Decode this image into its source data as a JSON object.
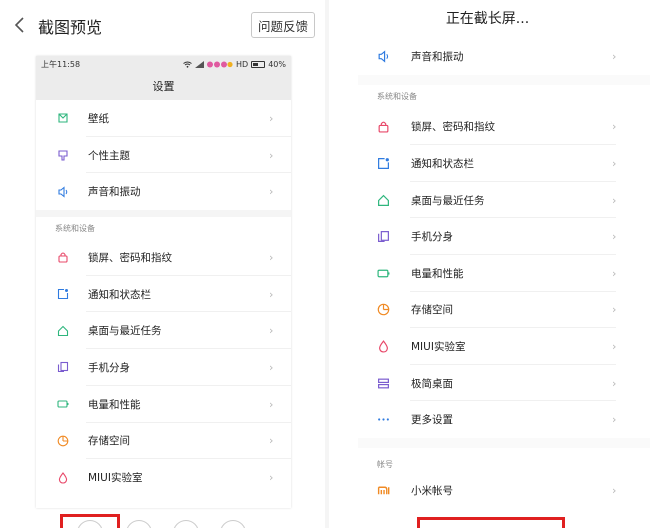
{
  "left": {
    "title": "截图预览",
    "feedback_label": "问题反馈",
    "preview": {
      "status_time": "上午11:58",
      "status_network": "HD",
      "status_battery": "40%",
      "title": "设置",
      "items_top": [
        {
          "label": "壁纸",
          "icon": "wallpaper-icon",
          "color": "#2eb67d"
        },
        {
          "label": "个性主题",
          "icon": "theme-icon",
          "color": "#7a5ccf"
        },
        {
          "label": "声音和振动",
          "icon": "sound-icon",
          "color": "#2f7be0"
        }
      ],
      "section_label": "系统和设备",
      "items_system": [
        {
          "label": "锁屏、密码和指纹",
          "icon": "lock-icon",
          "color": "#e8496a"
        },
        {
          "label": "通知和状态栏",
          "icon": "notification-icon",
          "color": "#2f7be0"
        },
        {
          "label": "桌面与最近任务",
          "icon": "home-icon",
          "color": "#2eb67d"
        },
        {
          "label": "手机分身",
          "icon": "clone-icon",
          "color": "#7a5ccf"
        },
        {
          "label": "电量和性能",
          "icon": "battery-icon",
          "color": "#2eb67d"
        },
        {
          "label": "存储空间",
          "icon": "storage-icon",
          "color": "#f08a24"
        },
        {
          "label": "MIUI实验室",
          "icon": "lab-icon",
          "color": "#e8496a"
        }
      ]
    }
  },
  "right": {
    "title": "正在截长屏...",
    "item_sound": {
      "label": "声音和振动",
      "icon": "sound-icon",
      "color": "#2f7be0"
    },
    "section_label": "系统和设备",
    "items_system": [
      {
        "label": "锁屏、密码和指纹",
        "icon": "lock-icon",
        "color": "#e8496a"
      },
      {
        "label": "通知和状态栏",
        "icon": "notification-icon",
        "color": "#2f7be0"
      },
      {
        "label": "桌面与最近任务",
        "icon": "home-icon",
        "color": "#2eb67d"
      },
      {
        "label": "手机分身",
        "icon": "clone-icon",
        "color": "#7a5ccf"
      },
      {
        "label": "电量和性能",
        "icon": "battery-icon",
        "color": "#2eb67d"
      },
      {
        "label": "存储空间",
        "icon": "storage-icon",
        "color": "#f08a24"
      },
      {
        "label": "MIUI实验室",
        "icon": "lab-icon",
        "color": "#e8496a"
      },
      {
        "label": "极简桌面",
        "icon": "simple-home-icon",
        "color": "#7a5ccf"
      },
      {
        "label": "更多设置",
        "icon": "more-icon",
        "color": "#2f7be0"
      }
    ],
    "account_section_label": "帐号",
    "item_account": {
      "label": "小米帐号",
      "icon": "mi-icon",
      "color": "#f08a24"
    }
  },
  "colors": {
    "highlight": "#e02020",
    "chevron": "#b8b8b8"
  }
}
